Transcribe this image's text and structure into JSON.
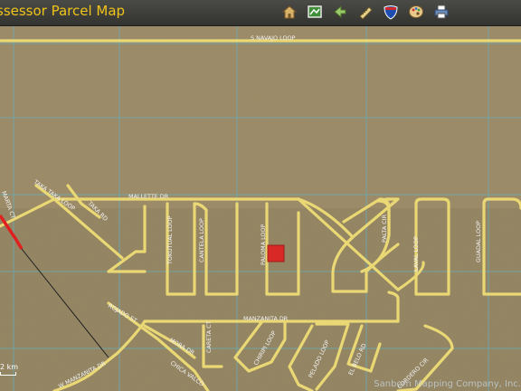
{
  "app": {
    "title": "ssessor Parcel Map"
  },
  "toolbar": {
    "tools": [
      {
        "name": "home-icon"
      },
      {
        "name": "map-layer-icon"
      },
      {
        "name": "back-arrow-icon"
      },
      {
        "name": "measure-icon"
      },
      {
        "name": "interstate-shield-icon"
      },
      {
        "name": "palette-icon"
      },
      {
        "name": "print-icon"
      }
    ]
  },
  "map": {
    "colors": {
      "terrain": "#9b8a66",
      "road": "#ead874",
      "grid": "#5fb3c7",
      "parcel": "#e02020"
    },
    "roads": [
      {
        "key": "navajo",
        "label": "S NAVAJO LOOP"
      },
      {
        "key": "mallette",
        "label": "MALLETTE DR"
      },
      {
        "key": "manzanita",
        "label": "MANZANITA DR"
      },
      {
        "key": "wmanzanita",
        "label": "W MANZANITA DR"
      },
      {
        "key": "takataka",
        "label": "TAKA TAKA LOOP"
      },
      {
        "key": "taka",
        "label": "TAKA RD"
      },
      {
        "key": "marta",
        "label": "MARTA CT"
      },
      {
        "key": "tokutual",
        "label": "TOKUTUAL LOOP"
      },
      {
        "key": "cantela",
        "label": "CANTELA LOOP"
      },
      {
        "key": "paloma",
        "label": "PALOMA LOOP"
      },
      {
        "key": "palta",
        "label": "PALTA CIR"
      },
      {
        "key": "laval",
        "label": "LAVAL LOOP"
      },
      {
        "key": "guadal",
        "label": "GUADAL LOOP"
      },
      {
        "key": "rojado",
        "label": "ROJADO ST"
      },
      {
        "key": "mora",
        "label": "MORA DR"
      },
      {
        "key": "careta",
        "label": "CARETA CT"
      },
      {
        "key": "chicavalco",
        "label": "CHICA VALCO"
      },
      {
        "key": "chiripi",
        "label": "CHIRIPI LOOP"
      },
      {
        "key": "pelado",
        "label": "PELADO LOOP"
      },
      {
        "key": "elbelo",
        "label": "EL BELO RD"
      },
      {
        "key": "cordero",
        "label": "CORDERO CIR"
      }
    ],
    "attribution": "Sanborn Mapping Company, Inc.",
    "scale_label": "2 km"
  }
}
